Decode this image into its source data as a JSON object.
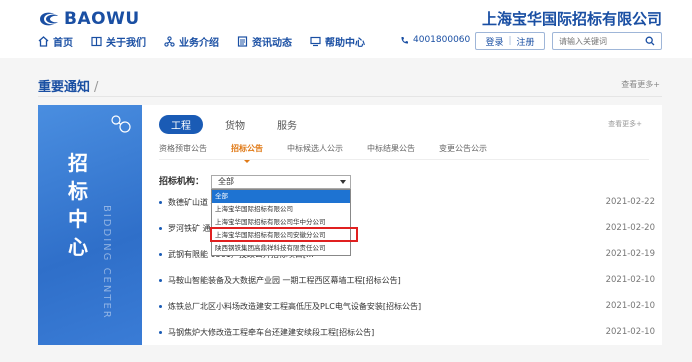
{
  "brand": {
    "logo_text": "BAOWU",
    "company": "上海宝华国际招标有限公司"
  },
  "nav": [
    {
      "label": "首页",
      "icon": "home-icon"
    },
    {
      "label": "关于我们",
      "icon": "book-icon"
    },
    {
      "label": "业务介绍",
      "icon": "network-icon"
    },
    {
      "label": "资讯动态",
      "icon": "document-icon"
    },
    {
      "label": "帮助中心",
      "icon": "monitor-icon"
    }
  ],
  "phone": "4001800060",
  "auth": {
    "login": "登录",
    "register": "注册"
  },
  "search": {
    "placeholder": "请输入关键词"
  },
  "section": {
    "title": "重要通知",
    "slash": "/",
    "more": "查看更多+"
  },
  "left_card": {
    "chars": [
      "招",
      "标",
      "中",
      "心"
    ],
    "vertical": "BIDDING CENTER"
  },
  "tabs": [
    {
      "label": "工程",
      "active": true
    },
    {
      "label": "货物"
    },
    {
      "label": "服务"
    }
  ],
  "inner_more": "查看更多+",
  "subtabs": [
    {
      "label": "资格预审公告"
    },
    {
      "label": "招标公告",
      "active": true
    },
    {
      "label": "中标候选人公示"
    },
    {
      "label": "中标结果公告"
    },
    {
      "label": "变更公告公示"
    }
  ],
  "org": {
    "label": "招标机构：",
    "selected": "全部",
    "options": [
      {
        "label": "全部",
        "selected": true
      },
      {
        "label": "上海宝华国际招标有限公司"
      },
      {
        "label": "上海宝华国际招标有限公司华中分公司"
      },
      {
        "label": "上海宝华国际招标有限公司安徽分公司"
      },
      {
        "label": "陕西钢铁集团高鼎祥科技有限责任公司"
      }
    ]
  },
  "rows": [
    {
      "title": "数德矿山道                                       标]公告]",
      "date": "2021-02-22"
    },
    {
      "title": "罗河铁矿                                          通廊土建工程[招标公告]",
      "date": "2021-02-20"
    },
    {
      "title": "武钢有限能                                        0561）技改公开招标项目[...",
      "date": "2021-02-19"
    },
    {
      "title": "马鞍山智能装备及大数据产业园 一期工程西区幕墙工程[招标公告]",
      "date": "2021-02-10"
    },
    {
      "title": "炼铁总厂北区小料场改造建安工程高低压及PLC电气设备安装[招标公告]",
      "date": "2021-02-10"
    },
    {
      "title": "马钢焦炉大修改造工程牵车台还建建安续段工程[招标公告]",
      "date": "2021-02-10"
    }
  ],
  "colors": {
    "brand_blue": "#1a4fa3",
    "accent_orange": "#e07a17",
    "highlight_red": "#e02020"
  }
}
